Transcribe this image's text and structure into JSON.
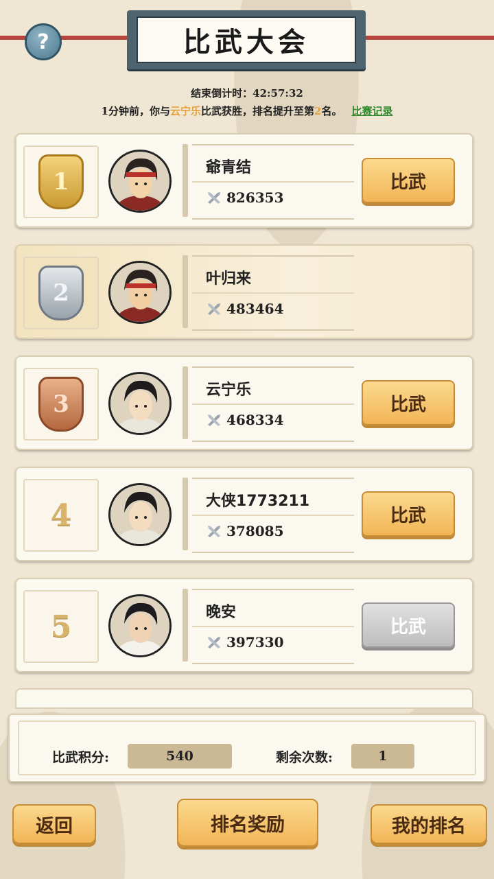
{
  "header": {
    "title": "比武大会",
    "help_icon": "?",
    "countdown": "结束倒计时：42:57:32",
    "notice_prefix": "1分钟前，你与",
    "notice_opponent": "云宁乐",
    "notice_middle": "比武获胜，排名提升至第",
    "notice_rank": "2",
    "notice_suffix": "名。",
    "record_link": "比赛记录"
  },
  "players": [
    {
      "rank": "1",
      "name": "爺青结",
      "power": "826353",
      "button": "比武",
      "button_enabled": true,
      "is_me": false,
      "medal": "gold"
    },
    {
      "rank": "2",
      "name": "叶归来",
      "power": "483464",
      "button": "",
      "button_enabled": false,
      "is_me": true,
      "medal": "silver"
    },
    {
      "rank": "3",
      "name": "云宁乐",
      "power": "468334",
      "button": "比武",
      "button_enabled": true,
      "is_me": false,
      "medal": "bronze"
    },
    {
      "rank": "4",
      "name": "大侠1773211",
      "power": "378085",
      "button": "比武",
      "button_enabled": true,
      "is_me": false,
      "medal": "none"
    },
    {
      "rank": "5",
      "name": "晚安",
      "power": "397330",
      "button": "比武",
      "button_enabled": false,
      "is_me": false,
      "medal": "none"
    }
  ],
  "status": {
    "points_label": "比武积分:",
    "points_value": "540",
    "remaining_label": "剩余次数:",
    "remaining_value": "1"
  },
  "buttons": {
    "back": "返回",
    "rewards": "排名奖励",
    "my_rank": "我的排名"
  },
  "colors": {
    "accent_orange": "#f2b556",
    "highlight_text": "#e8a13a",
    "link_green": "#2f8a2c"
  }
}
